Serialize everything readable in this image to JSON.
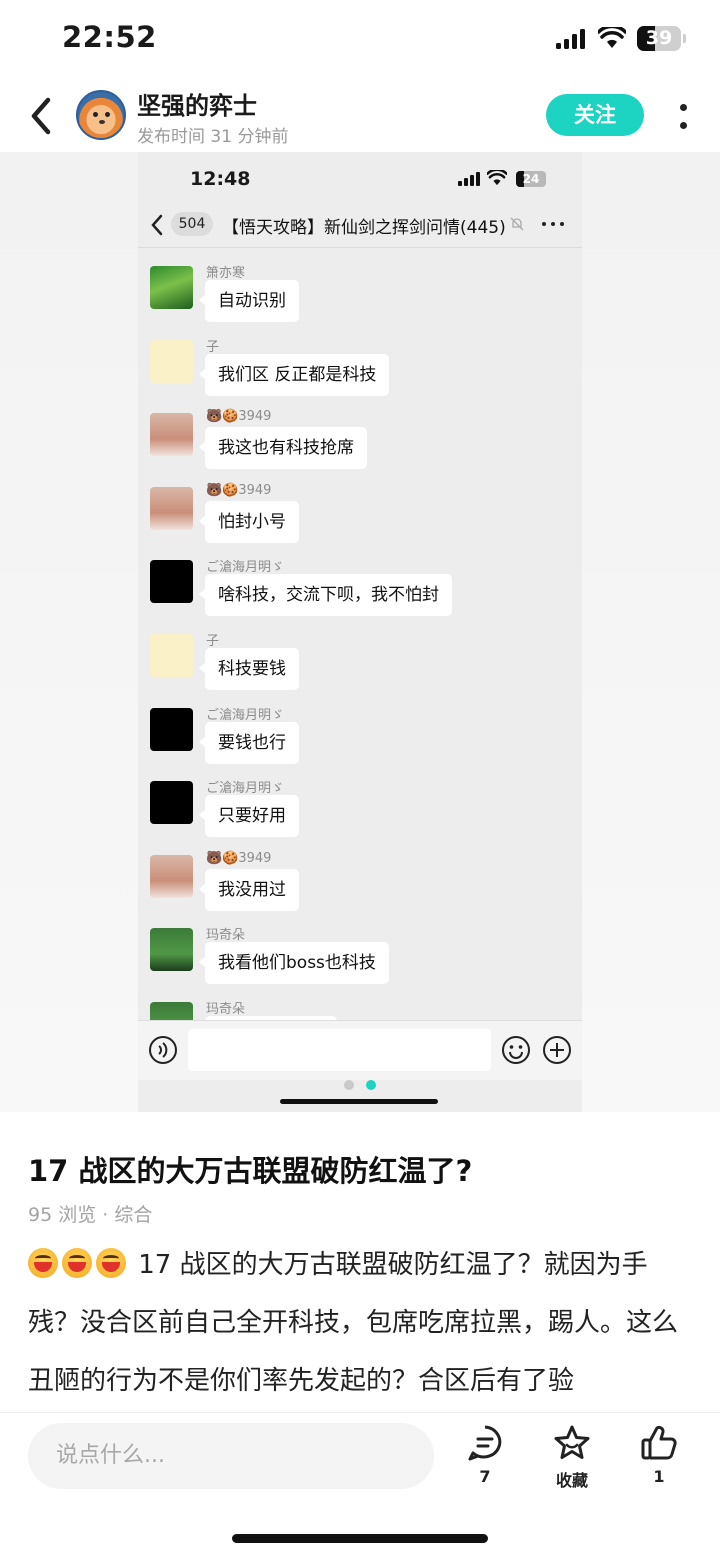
{
  "status_bar": {
    "time": "22:52",
    "battery": "39"
  },
  "header": {
    "username": "坚强的弈士",
    "publish_time": "发布时间 31 分钟前",
    "follow_label": "关注"
  },
  "screenshot": {
    "status_bar": {
      "time": "12:48",
      "battery": "24"
    },
    "chat": {
      "back_count": "504",
      "title": "【悟天攻略】新仙剑之挥剑问情(445)",
      "messages": [
        {
          "name": "箫亦寒",
          "text": "自动识别",
          "avatar": "forest"
        },
        {
          "name": "子",
          "text": "我们区 反正都是科技",
          "avatar": "bear"
        },
        {
          "name": "🐻🍪3949",
          "text": "我这也有科技抢席",
          "avatar": "girl"
        },
        {
          "name": "🐻🍪3949",
          "text": "怕封小号",
          "avatar": "girl"
        },
        {
          "name": "ご滄海月明ゞ",
          "text": "啥科技，交流下呗，我不怕封",
          "avatar": "moon"
        },
        {
          "name": "子",
          "text": "科技要钱",
          "avatar": "bear"
        },
        {
          "name": "ご滄海月明ゞ",
          "text": "要钱也行",
          "avatar": "moon"
        },
        {
          "name": "ご滄海月明ゞ",
          "text": "只要好用",
          "avatar": "moon"
        },
        {
          "name": "🐻🍪3949",
          "text": "我没用过",
          "avatar": "girl"
        },
        {
          "name": "玛奇朵",
          "text": "我看他们boss也科技",
          "avatar": "green"
        },
        {
          "name": "玛奇朵",
          "text": "",
          "avatar": "green"
        }
      ]
    }
  },
  "post": {
    "title": "17 战区的大万古联盟破防红温了?",
    "meta": "95 浏览 · 综合",
    "body": "17 战区的大万古联盟破防红温了？就因为手残？没合区前自己全开科技，包席吃席拉黑，踢人。这么丑陋的行为不是你们率先发起的？合区后有了验"
  },
  "bottom_bar": {
    "comment_placeholder": "说点什么...",
    "comment_count": "7",
    "favorite_label": "收藏",
    "like_count": "1"
  },
  "colors": {
    "accent": "#1dd3c2",
    "bubble": "#ffffff",
    "chat_bg": "#ededed"
  }
}
